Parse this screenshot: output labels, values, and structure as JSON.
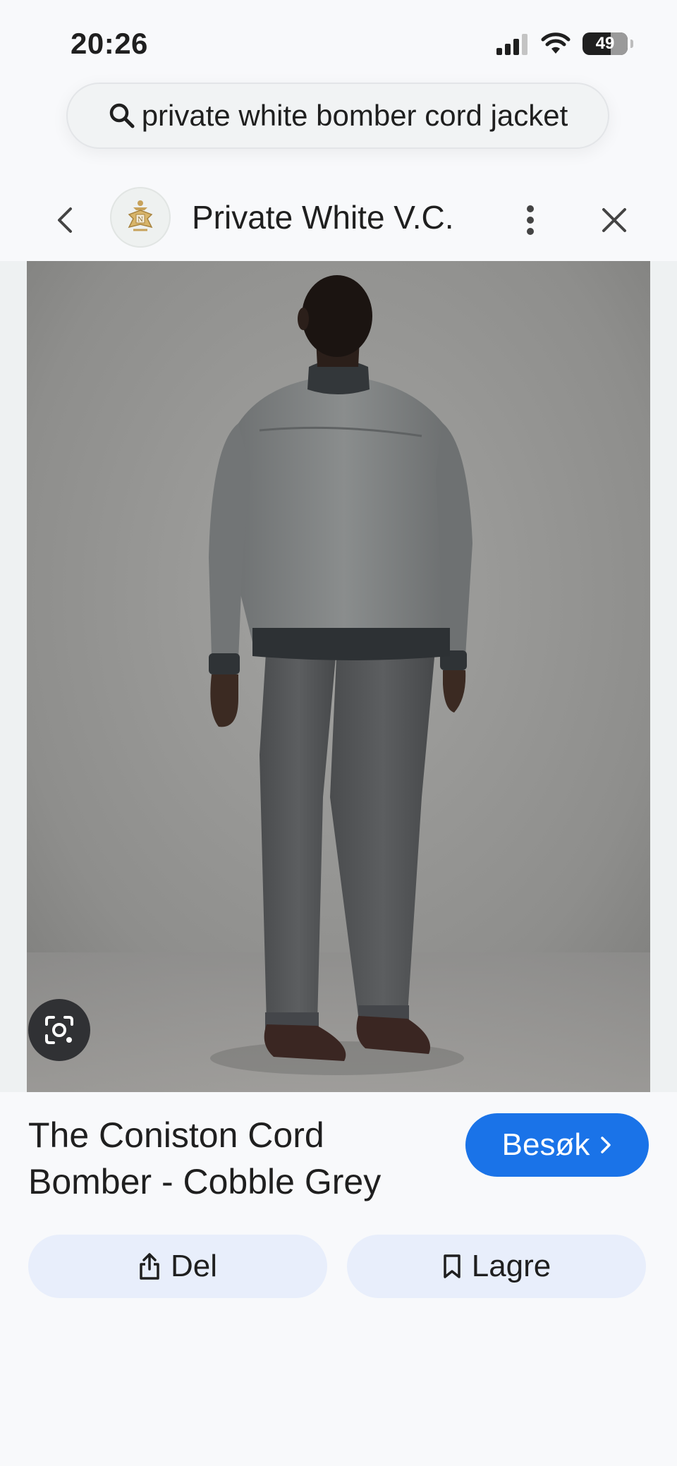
{
  "status_bar": {
    "time": "20:26",
    "battery": "49"
  },
  "search": {
    "query": "private white bomber cord jacket"
  },
  "header": {
    "site_name": "Private White V.C."
  },
  "product": {
    "title": "The Coniston Cord Bomber - Cobble Grey",
    "visit_label": "Besøk"
  },
  "actions": {
    "share_label": "Del",
    "save_label": "Lagre"
  },
  "colors": {
    "accent": "#1a73e8",
    "action_bg": "#e8eefb",
    "page_bg": "#f8f9fb"
  }
}
